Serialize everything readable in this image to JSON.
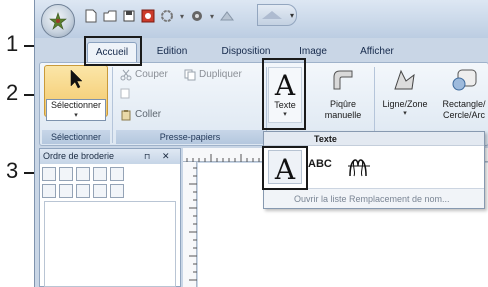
{
  "callouts": {
    "one": "1",
    "two": "2",
    "three": "3"
  },
  "tabs": [
    "Accueil",
    "Edition",
    "Disposition",
    "Image",
    "Afficher"
  ],
  "ribbon": {
    "select_label": "Sélectionner",
    "select_group": "Sélectionner",
    "couper": "Couper",
    "dupliquer": "Dupliquer",
    "coller": "Coller",
    "clipboard_group": "Presse-papiers",
    "texte_label": "Texte",
    "piqure_line1": "Piqûre",
    "piqure_line2": "manuelle",
    "ligne_zone": "Ligne/Zone",
    "rect_line1": "Rectangle/",
    "rect_line2": "Cercle/Arc"
  },
  "panel": {
    "title": "Ordre de broderie",
    "pin": "ⅅ",
    "close": "✕"
  },
  "gallery": {
    "header": "Texte",
    "item_abc": "ABC",
    "footer": "Ouvrir la liste Remplacement de nom..."
  },
  "icons": [
    "app-orb-icon",
    "new-file-icon",
    "open-folder-icon",
    "save-icon",
    "undo-icon",
    "redo-icon",
    "pointer-icon",
    "text-a-icon",
    "manual-stitch-icon",
    "line-zone-icon",
    "rectangle-icon",
    "monogram-icon"
  ],
  "colors": {
    "highlight": "#1a1a1a",
    "ribbon_bg": "#dde7f2",
    "window_frame": "#c9d6e6"
  }
}
